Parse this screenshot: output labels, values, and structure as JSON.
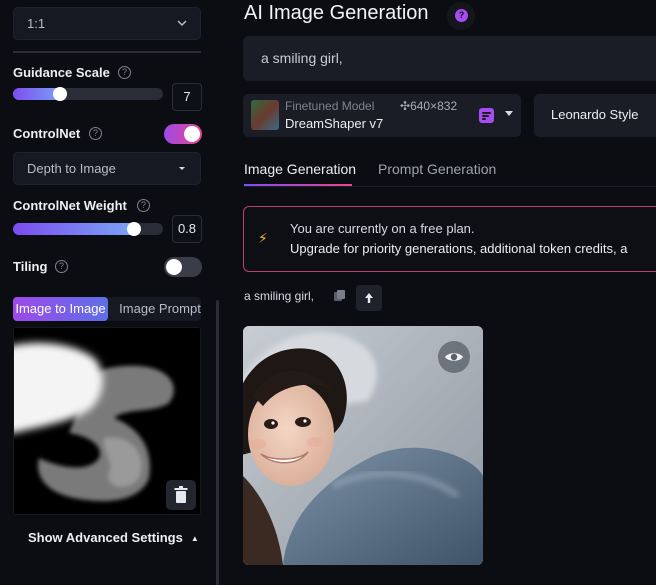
{
  "sidebar": {
    "aspect_select": {
      "value": "1:1"
    },
    "guidance": {
      "label": "Guidance Scale",
      "value": "7",
      "fraction": 0.32
    },
    "controlnet": {
      "label": "ControlNet",
      "enabled": true,
      "mode": "Depth to Image"
    },
    "controlnet_weight": {
      "label": "ControlNet Weight",
      "value": "0.8",
      "fraction": 0.8
    },
    "tiling": {
      "label": "Tiling",
      "enabled": false
    },
    "image_tabs": {
      "active": "Image to Image",
      "inactive": "Image Prompt"
    },
    "advanced_label": "Show Advanced Settings"
  },
  "main": {
    "title": "AI Image Generation",
    "prompt": "a smiling girl,",
    "model": {
      "subtitle": "Finetuned Model",
      "dimensions": "640×832",
      "name": "DreamShaper v7"
    },
    "style": "Leonardo Style",
    "tabs": {
      "active": "Image Generation",
      "inactive": "Prompt Generation"
    },
    "plan": {
      "line1": "You are currently on a free plan.",
      "line2": "Upgrade for priority generations, additional token credits, a"
    },
    "generation_prompt": "a smiling girl,"
  },
  "colors": {
    "accent": "#a64cf0",
    "gradient_start": "#7c4df0",
    "gradient_end": "#7aa7f7",
    "alert_border": "#b8436a"
  },
  "icons": [
    "chevron-down-icon",
    "help-icon",
    "copy-icon",
    "arrow-up-icon",
    "eye-icon",
    "trash-icon",
    "lightning-icon",
    "prompt-badge-icon"
  ]
}
